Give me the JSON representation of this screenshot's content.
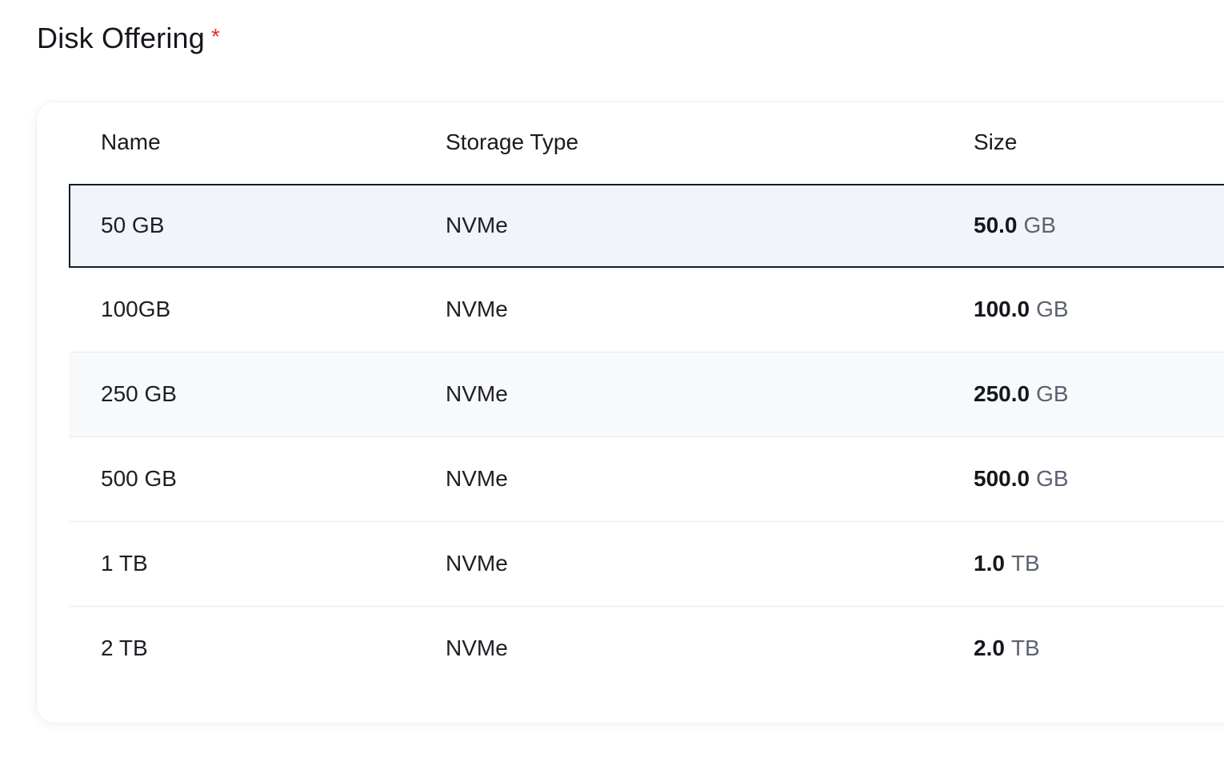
{
  "section": {
    "title": "Disk Offering",
    "required_mark": "*"
  },
  "table": {
    "columns": [
      "Name",
      "Storage Type",
      "Size"
    ],
    "selected_row": 0,
    "rows": [
      {
        "name": "50 GB",
        "storage_type": "NVMe",
        "size_value": "50.0",
        "size_unit": "GB"
      },
      {
        "name": "100GB",
        "storage_type": "NVMe",
        "size_value": "100.0",
        "size_unit": "GB"
      },
      {
        "name": "250 GB",
        "storage_type": "NVMe",
        "size_value": "250.0",
        "size_unit": "GB"
      },
      {
        "name": "500 GB",
        "storage_type": "NVMe",
        "size_value": "500.0",
        "size_unit": "GB"
      },
      {
        "name": "1 TB",
        "storage_type": "NVMe",
        "size_value": "1.0",
        "size_unit": "TB"
      },
      {
        "name": "2 TB",
        "storage_type": "NVMe",
        "size_value": "2.0",
        "size_unit": "TB"
      }
    ]
  },
  "colors": {
    "required": "#e0322a",
    "selected_border": "#131a2e",
    "selected_background": "#f1f4f9"
  }
}
